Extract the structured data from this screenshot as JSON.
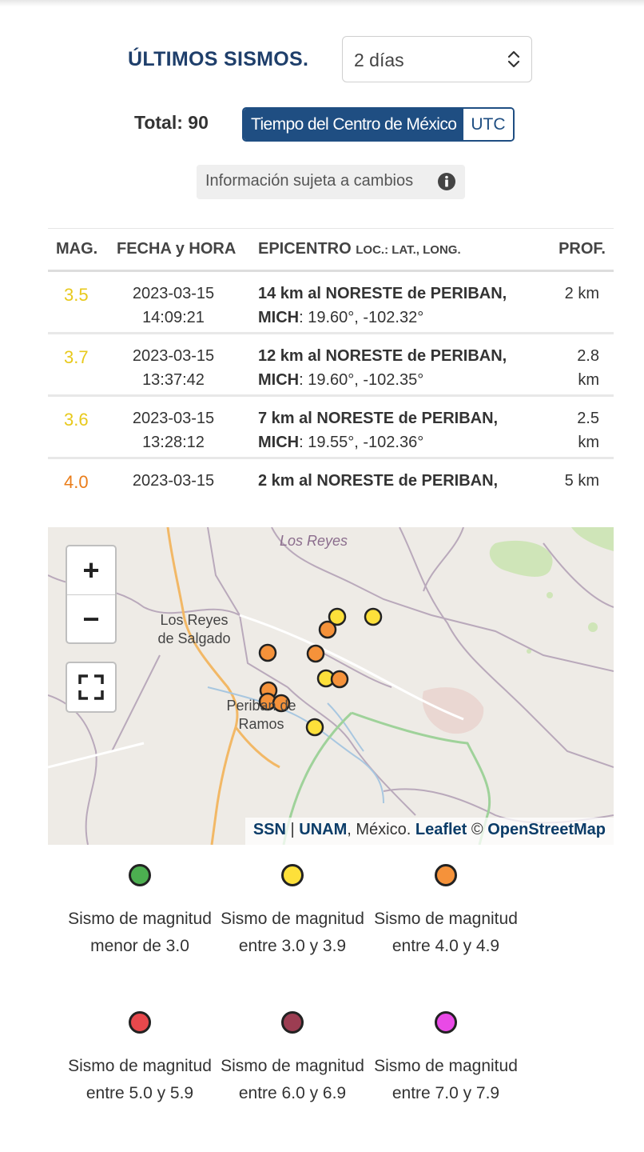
{
  "header": {
    "title": "ÚLTIMOS SISMOS.",
    "period_select": {
      "value": "2 días"
    },
    "total": "Total: 90",
    "timezone_options": [
      {
        "label": "Tiempo del Centro de México",
        "active": true
      },
      {
        "label": "UTC",
        "active": false
      }
    ],
    "info_text": "Información sujeta a cambios"
  },
  "table": {
    "columns": {
      "mag": "MAG.",
      "date": "FECHA y HORA",
      "epicentro": "EPICENTRO",
      "loc": "LOC.: LAT., LONG.",
      "prof": "PROF."
    },
    "rows": [
      {
        "mag": "3.5",
        "mag_color": "#e8c91c",
        "date": "2023-03-15",
        "time": "14:09:21",
        "place": "14 km al NORESTE de PERIBAN, MICH",
        "coords": ": 19.60°, -102.32°",
        "prof": "2 km"
      },
      {
        "mag": "3.7",
        "mag_color": "#e8c91c",
        "date": "2023-03-15",
        "time": "13:37:42",
        "place": "12 km al NORESTE de PERIBAN, MICH",
        "coords": ": 19.60°, -102.35°",
        "prof": "2.8 km"
      },
      {
        "mag": "3.6",
        "mag_color": "#e8c91c",
        "date": "2023-03-15",
        "time": "13:28:12",
        "place": "7 km al NORESTE de PERIBAN, MICH",
        "coords": ": 19.55°, -102.36°",
        "prof": "2.5 km"
      },
      {
        "mag": "4.0",
        "mag_color": "#ea7d1a",
        "date": "2023-03-15",
        "time": "",
        "place": "2 km al NORESTE de PERIBAN,",
        "coords": "",
        "prof": "5 km"
      }
    ]
  },
  "map": {
    "labels": {
      "los_reyes_top": "Los Reyes",
      "los_reyes_salgado": "Los Reyes\nde Salgado",
      "periban": "Periban de\nRamos"
    },
    "zoom_in": "+",
    "zoom_out": "−",
    "attribution": {
      "ssn": "SSN",
      "sep": " | ",
      "unam": "UNAM",
      "mexico": ", México. ",
      "leaflet": "Leaflet",
      "copy": " © ",
      "osm": "OpenStreetMap"
    }
  },
  "legend": [
    {
      "color": "#4caf50",
      "text": "Sismo de magnitud menor de 3.0"
    },
    {
      "color": "#fde03a",
      "text": "Sismo de magnitud entre 3.0 y 3.9"
    },
    {
      "color": "#f5923a",
      "text": "Sismo de magnitud entre 4.0 y 4.9"
    },
    {
      "color": "#e8484c",
      "text": "Sismo de magnitud entre 5.0 y 5.9"
    },
    {
      "color": "#9c3d52",
      "text": "Sismo de magnitud entre 6.0 y 6.9"
    },
    {
      "color": "#e94ae6",
      "text": "Sismo de magnitud entre 7.0 y 7.9"
    }
  ],
  "colors": {
    "brand": "#1f4e82",
    "title": "#1f3f6b"
  }
}
